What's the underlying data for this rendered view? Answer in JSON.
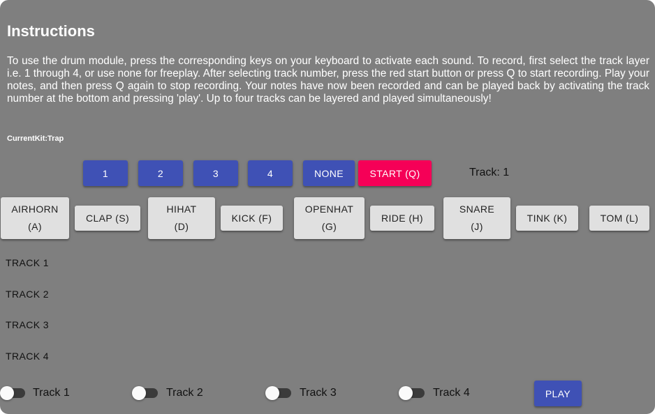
{
  "instructions": {
    "title": "Instructions",
    "text": "To use the drum module, press the corresponding keys on your keyboard to activate each sound. To record, first select the track layer i.e. 1 through 4, or use none for freeplay. After selecting track number, press the red start button or press Q to start recording. Play your notes, and then press Q again to stop recording. Your notes have now been recorded and can be played back by activating the track number at the bottom and pressing 'play'. Up to four tracks can be layered and played simultaneously!",
    "current_kit": "CurrentKit:Trap"
  },
  "track_select": {
    "buttons": [
      "1",
      "2",
      "3",
      "4",
      "NONE"
    ],
    "start_label": "START (Q)",
    "current_track": "Track: 1"
  },
  "pads": {
    "airhorn": {
      "name": "AIRHORN",
      "key": "(A)"
    },
    "clap": {
      "label": "CLAP (S)"
    },
    "hihat": {
      "name": "HIHAT",
      "key": "(D)"
    },
    "kick": {
      "label": "KICK (F)"
    },
    "openhat": {
      "name": "OPENHAT",
      "key": "(G)"
    },
    "ride": {
      "label": "RIDE (H)"
    },
    "snare": {
      "name": "SNARE",
      "key": "(J)"
    },
    "tink": {
      "label": "TINK (K)"
    },
    "tom": {
      "label": "TOM (L)"
    }
  },
  "tracks": [
    "TRACK 1",
    "TRACK 2",
    "TRACK 3",
    "TRACK 4"
  ],
  "playback": {
    "toggles": [
      {
        "label": "Track 1",
        "on": false
      },
      {
        "label": "Track 2",
        "on": false
      },
      {
        "label": "Track 3",
        "on": false
      },
      {
        "label": "Track 4",
        "on": false
      }
    ],
    "play_label": "PLAY"
  },
  "colors": {
    "panel": "#7f7f7f",
    "primary": "#3f51b5",
    "secondary": "#f50057",
    "pad": "#e0e0e0"
  }
}
